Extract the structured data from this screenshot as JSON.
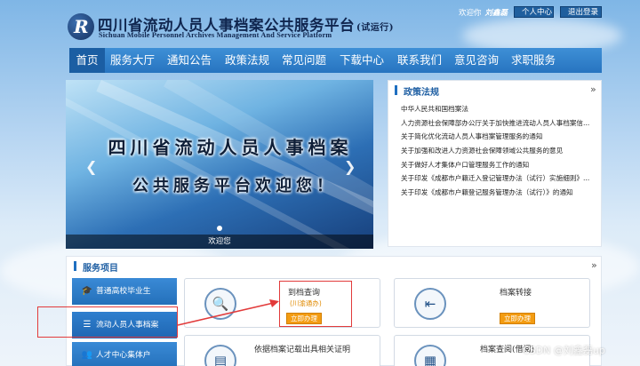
{
  "header": {
    "title": "四川省流动人员人事档案公共服务平台",
    "title_suffix": "(试运行)",
    "subtitle": "Sichuan Mobile Personnel Archives Management And Service Platform",
    "welcome_text": "欢迎你",
    "username": "刘鑫磊",
    "personal_center_label": "个人中心",
    "logout_label": "退出登录"
  },
  "nav": {
    "items": [
      {
        "label": "首页",
        "active": true
      },
      {
        "label": "服务大厅"
      },
      {
        "label": "通知公告"
      },
      {
        "label": "政策法规"
      },
      {
        "label": "常见问题"
      },
      {
        "label": "下载中心"
      },
      {
        "label": "联系我们"
      },
      {
        "label": "意见咨询"
      },
      {
        "label": "求职服务"
      }
    ]
  },
  "carousel": {
    "line1": "四川省流动人员人事档案",
    "line2": "公共服务平台欢迎您！",
    "caption": "欢迎您",
    "prev_icon": "chevron-left-icon",
    "next_icon": "chevron-right-icon"
  },
  "policy": {
    "title": "政策法规",
    "more": "»",
    "items": [
      "中华人民共和国档案法",
      "人力资源社会保障部办公厅关于加快推进流动人员人事档案信...",
      "关于简化优化流动人员人事档案管理服务的通知",
      "关于加强和改进人力资源社会保障领域公共服务的意见",
      "关于做好人才集体户口管理服务工作的通知",
      "关于印发《成都市户籍迁入登记管理办法（试行）实施细则》...",
      "关于印发《成都市户籍登记服务管理办法（试行）》的通知"
    ]
  },
  "services": {
    "title": "服务项目",
    "more": "»",
    "side_items": [
      {
        "label": "普通高校毕业生",
        "icon": "graduation-cap-icon"
      },
      {
        "label": "流动人员人事档案",
        "icon": "list-icon"
      },
      {
        "label": "人才中心集体户",
        "icon": "users-icon"
      }
    ],
    "cards": [
      {
        "title": "到档查询",
        "subtitle": "(川渝通办)",
        "button": "立即办理",
        "icon": "document-search-icon"
      },
      {
        "title": "档案转接",
        "button": "立即办理",
        "icon": "transfer-arrow-icon"
      },
      {
        "title": "依据档案记载出具相关证明",
        "icon": "certificate-icon"
      },
      {
        "title": "档案查阅(借阅)",
        "icon": "archive-read-icon"
      }
    ]
  },
  "watermark": "CSDN @刘鑫磊up",
  "colors": {
    "nav_blue": "#2774c0",
    "button_orange": "#f39c12",
    "annotation_red": "#e23b3b"
  }
}
